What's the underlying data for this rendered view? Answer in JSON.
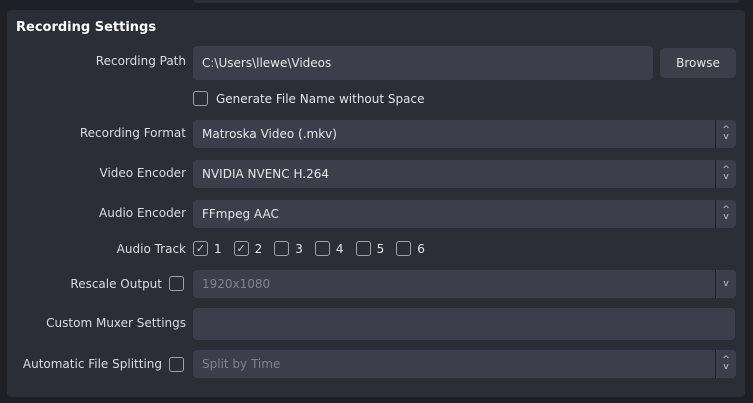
{
  "section_title": "Recording Settings",
  "recording_path": {
    "label": "Recording Path",
    "value": "C:\\Users\\llewe\\Videos",
    "browse": "Browse"
  },
  "gen_filename": {
    "label": "Generate File Name without Space",
    "checked": false
  },
  "format": {
    "label": "Recording Format",
    "value": "Matroska Video (.mkv)"
  },
  "video_encoder": {
    "label": "Video Encoder",
    "value": "NVIDIA NVENC H.264"
  },
  "audio_encoder": {
    "label": "Audio Encoder",
    "value": "FFmpeg AAC"
  },
  "audio_track": {
    "label": "Audio Track",
    "tracks": [
      {
        "n": "1",
        "checked": true
      },
      {
        "n": "2",
        "checked": true
      },
      {
        "n": "3",
        "checked": false
      },
      {
        "n": "4",
        "checked": false
      },
      {
        "n": "5",
        "checked": false
      },
      {
        "n": "6",
        "checked": false
      }
    ]
  },
  "rescale": {
    "label": "Rescale Output",
    "value": "1920x1080",
    "checked": false
  },
  "muxer": {
    "label": "Custom Muxer Settings",
    "value": ""
  },
  "splitting": {
    "label": "Automatic File Splitting",
    "value": "Split by Time",
    "checked": false
  }
}
